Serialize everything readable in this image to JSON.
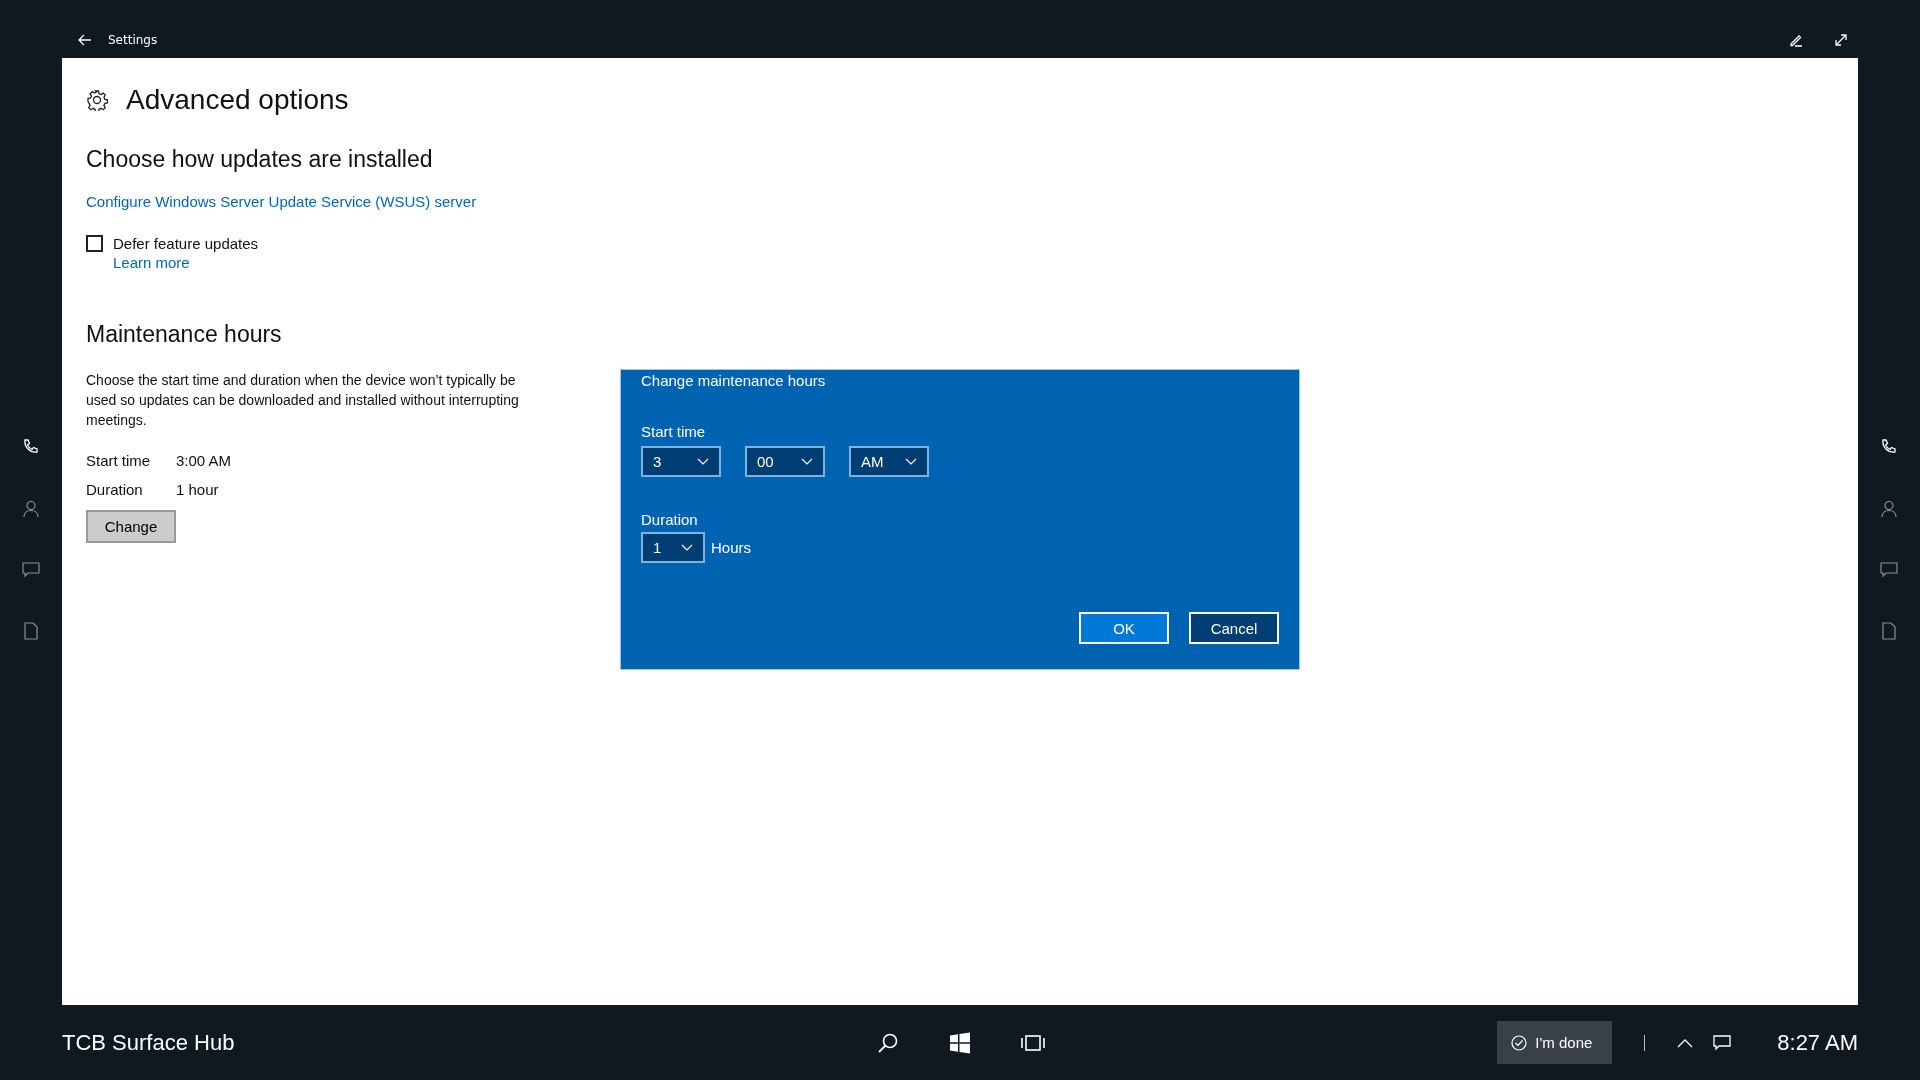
{
  "title_bar": {
    "title": "Settings"
  },
  "page": {
    "title": "Advanced options",
    "install_section": {
      "heading": "Choose how updates are installed",
      "link": "Configure Windows Server Update Service (WSUS) server",
      "defer": {
        "label": "Defer feature updates",
        "checked": false,
        "link": "Learn more"
      }
    },
    "maintenance_section": {
      "heading": "Maintenance hours",
      "description": "Choose the start time and duration when the device won’t typically be used so updates can be downloaded and installed without interrupting meetings.",
      "rows": [
        {
          "label": "Start time",
          "value": "3:00 AM"
        },
        {
          "label": "Duration",
          "value": "1 hour"
        }
      ],
      "button": "Change"
    }
  },
  "dialog": {
    "title": "Change maintenance hours",
    "start_label": "Start time",
    "start_dropdowns": [
      {
        "value": "3"
      },
      {
        "value": "00"
      },
      {
        "value": "AM"
      }
    ],
    "duration_label": "Duration",
    "duration_dropdown": {
      "value": "1"
    },
    "duration_unit": "Hours",
    "buttons": [
      {
        "label": "OK",
        "kind": "primary"
      },
      {
        "label": "Cancel",
        "kind": "secondary"
      }
    ]
  },
  "taskbar": {
    "device_name": "TCB Surface Hub",
    "done_button": "I'm done",
    "time": "8:27 AM"
  }
}
